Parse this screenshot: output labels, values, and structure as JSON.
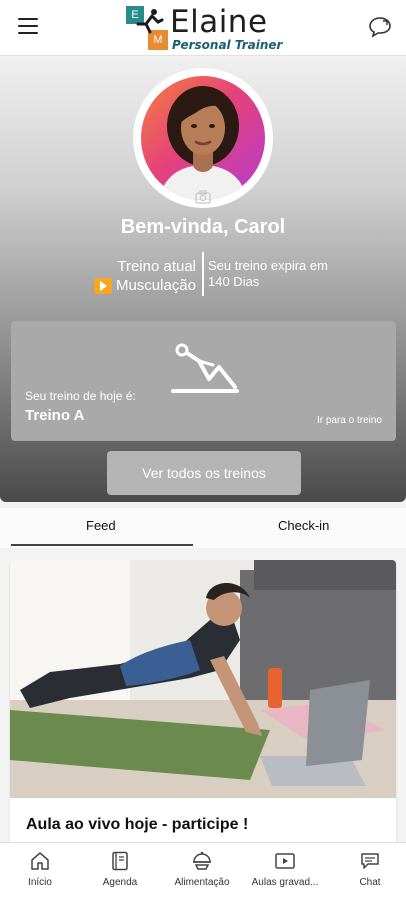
{
  "header": {
    "logo_name": "Elaine",
    "logo_subtitle": "Personal Trainer",
    "logo_letters": [
      "E",
      "M"
    ],
    "menu_icon": "hamburger-icon",
    "chat_icon": "chat-bubble-icon"
  },
  "profile": {
    "welcome": "Bem-vinda, Carol",
    "training_label": "Treino atual",
    "training_type": "Musculação",
    "expiry_line1": "Seu treino expira em",
    "expiry_line2": "140 Dias"
  },
  "today": {
    "label": "Seu treino de hoje é:",
    "name": "Treino A",
    "link": "Ir para o treino"
  },
  "buttons": {
    "all_workouts": "Ver todos os treinos"
  },
  "tabs": [
    {
      "label": "Feed",
      "active": true
    },
    {
      "label": "Check-in",
      "active": false
    }
  ],
  "feed": {
    "title": "Aula ao vivo hoje - participe !"
  },
  "bottom_nav": [
    {
      "label": "Início",
      "icon": "home-icon"
    },
    {
      "label": "Agenda",
      "icon": "agenda-icon"
    },
    {
      "label": "Alimentação",
      "icon": "food-icon"
    },
    {
      "label": "Aulas gravad...",
      "icon": "video-icon"
    },
    {
      "label": "Chat",
      "icon": "chat-icon"
    }
  ],
  "colors": {
    "accent_teal": "#2a8b8f",
    "accent_orange": "#e88b32",
    "play_badge": "#f5a623"
  }
}
